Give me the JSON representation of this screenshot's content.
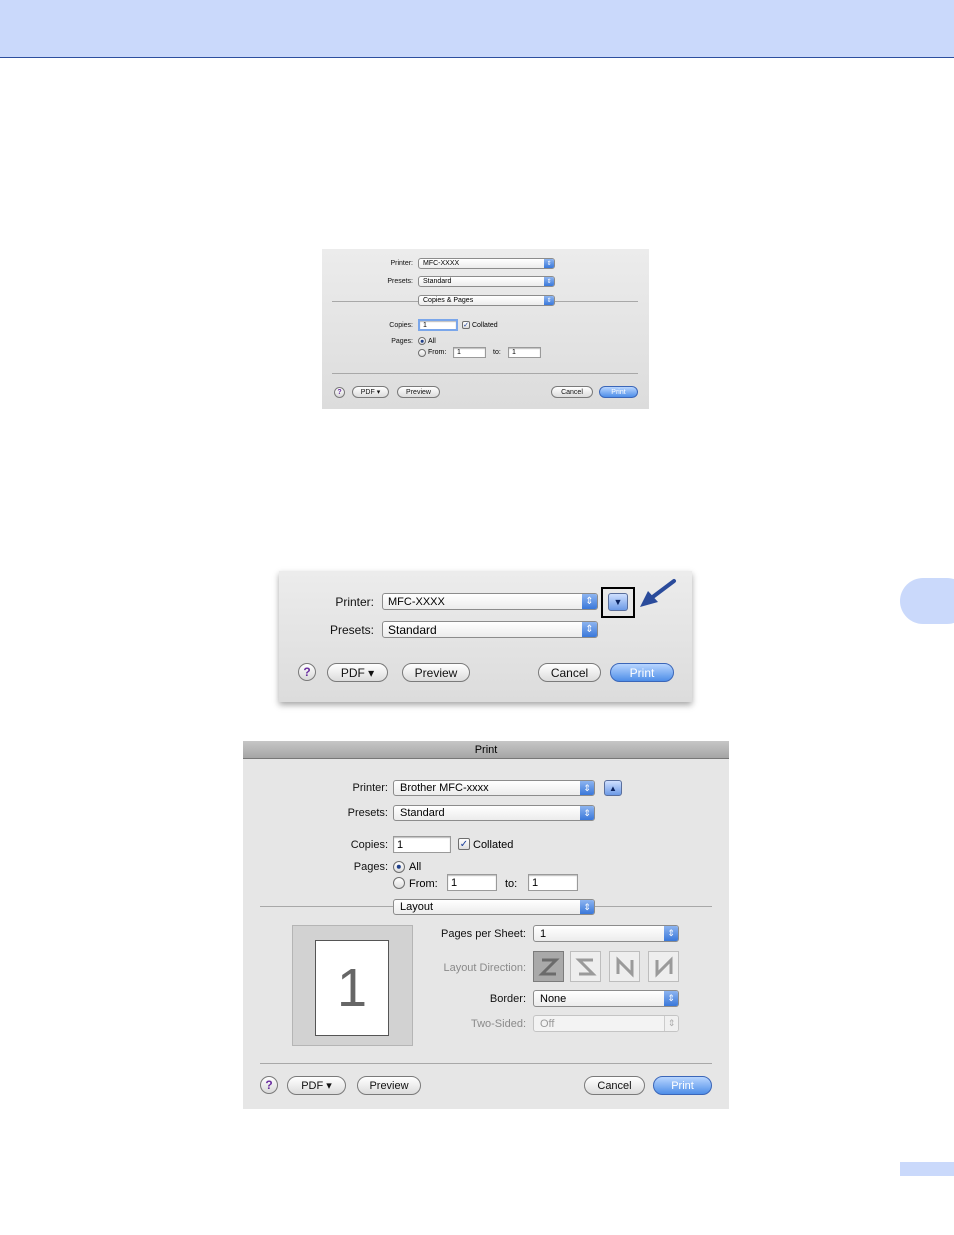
{
  "colors": {
    "header_band": "#cad9fb",
    "accent": "#3a78da",
    "callout_arrow": "#2a4b9b"
  },
  "dialog1": {
    "printer_label": "Printer:",
    "printer_value": "MFC-XXXX",
    "presets_label": "Presets:",
    "presets_value": "Standard",
    "panel_value": "Copies & Pages",
    "copies_label": "Copies:",
    "copies_value": "1",
    "collated_label": "Collated",
    "pages_label": "Pages:",
    "all_label": "All",
    "from_label": "From:",
    "from_value": "1",
    "to_label": "to:",
    "to_value": "1",
    "help_label": "?",
    "pdf_label": "PDF ▾",
    "preview_label": "Preview",
    "cancel_label": "Cancel",
    "print_label": "Print"
  },
  "dialog2": {
    "printer_label": "Printer:",
    "printer_value": "MFC-XXXX",
    "presets_label": "Presets:",
    "presets_value": "Standard",
    "disclosure_icon": "triangle-down-icon",
    "help_label": "?",
    "pdf_label": "PDF ▾",
    "preview_label": "Preview",
    "cancel_label": "Cancel",
    "print_label": "Print"
  },
  "dialog3": {
    "title": "Print",
    "printer_label": "Printer:",
    "printer_value": "Brother MFC-xxxx",
    "presets_label": "Presets:",
    "presets_value": "Standard",
    "copies_label": "Copies:",
    "copies_value": "1",
    "collated_label": "Collated",
    "pages_label": "Pages:",
    "all_label": "All",
    "from_label": "From:",
    "from_value": "1",
    "to_label": "to:",
    "to_value": "1",
    "panel_value": "Layout",
    "preview_page_number": "1",
    "pages_per_sheet_label": "Pages per Sheet:",
    "pages_per_sheet_value": "1",
    "layout_direction_label": "Layout Direction:",
    "border_label": "Border:",
    "border_value": "None",
    "two_sided_label": "Two-Sided:",
    "two_sided_value": "Off",
    "help_label": "?",
    "pdf_label": "PDF ▾",
    "preview_label": "Preview",
    "cancel_label": "Cancel",
    "print_label": "Print"
  }
}
